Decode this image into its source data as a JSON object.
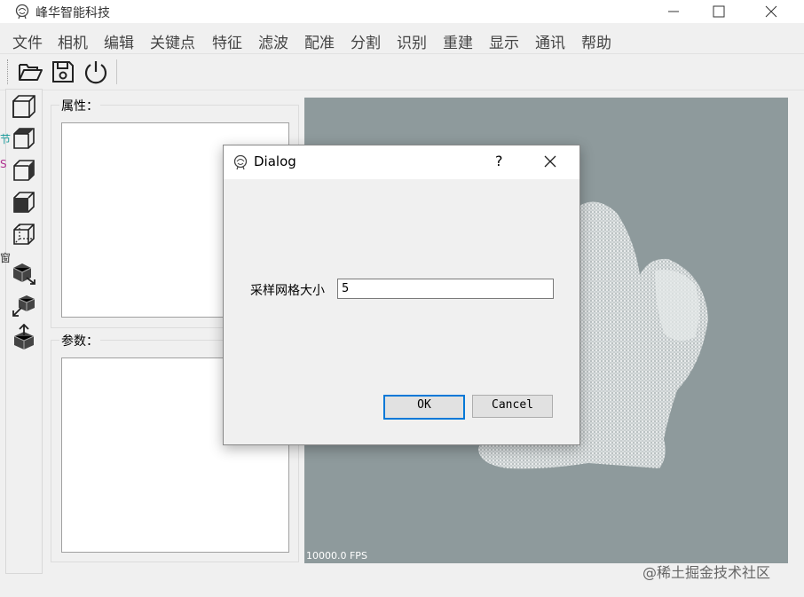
{
  "window": {
    "title": "峰华智能科技",
    "icon": "brain-head-icon"
  },
  "menu": [
    "文件",
    "相机",
    "编辑",
    "关键点",
    "特征",
    "滤波",
    "配准",
    "分割",
    "识别",
    "重建",
    "显示",
    "通讯",
    "帮助"
  ],
  "toolbar": {
    "icons": [
      "open-folder-icon",
      "save-icon",
      "power-icon"
    ]
  },
  "sidebar": {
    "icons": [
      "cube-front-icon",
      "cube-top-icon",
      "cube-side-icon",
      "cube-left-icon",
      "cube-iso-icon",
      "cube-export-icon",
      "cube-import-icon",
      "cube-up-icon"
    ],
    "fragments": [
      "节",
      "S",
      "窗"
    ]
  },
  "panels": {
    "properties_label": "属性：",
    "params_label": "参数："
  },
  "viewer": {
    "fps": "10000.0 FPS",
    "background": "#8e9a9c",
    "content": "bunny point cloud"
  },
  "dialog": {
    "title": "Dialog",
    "help": "?",
    "field_label": "采样网格大小",
    "field_value": "5",
    "ok_label": "OK",
    "cancel_label": "Cancel"
  },
  "watermark": "@稀土掘金技术社区",
  "colors": {
    "accent": "#0078d7"
  }
}
